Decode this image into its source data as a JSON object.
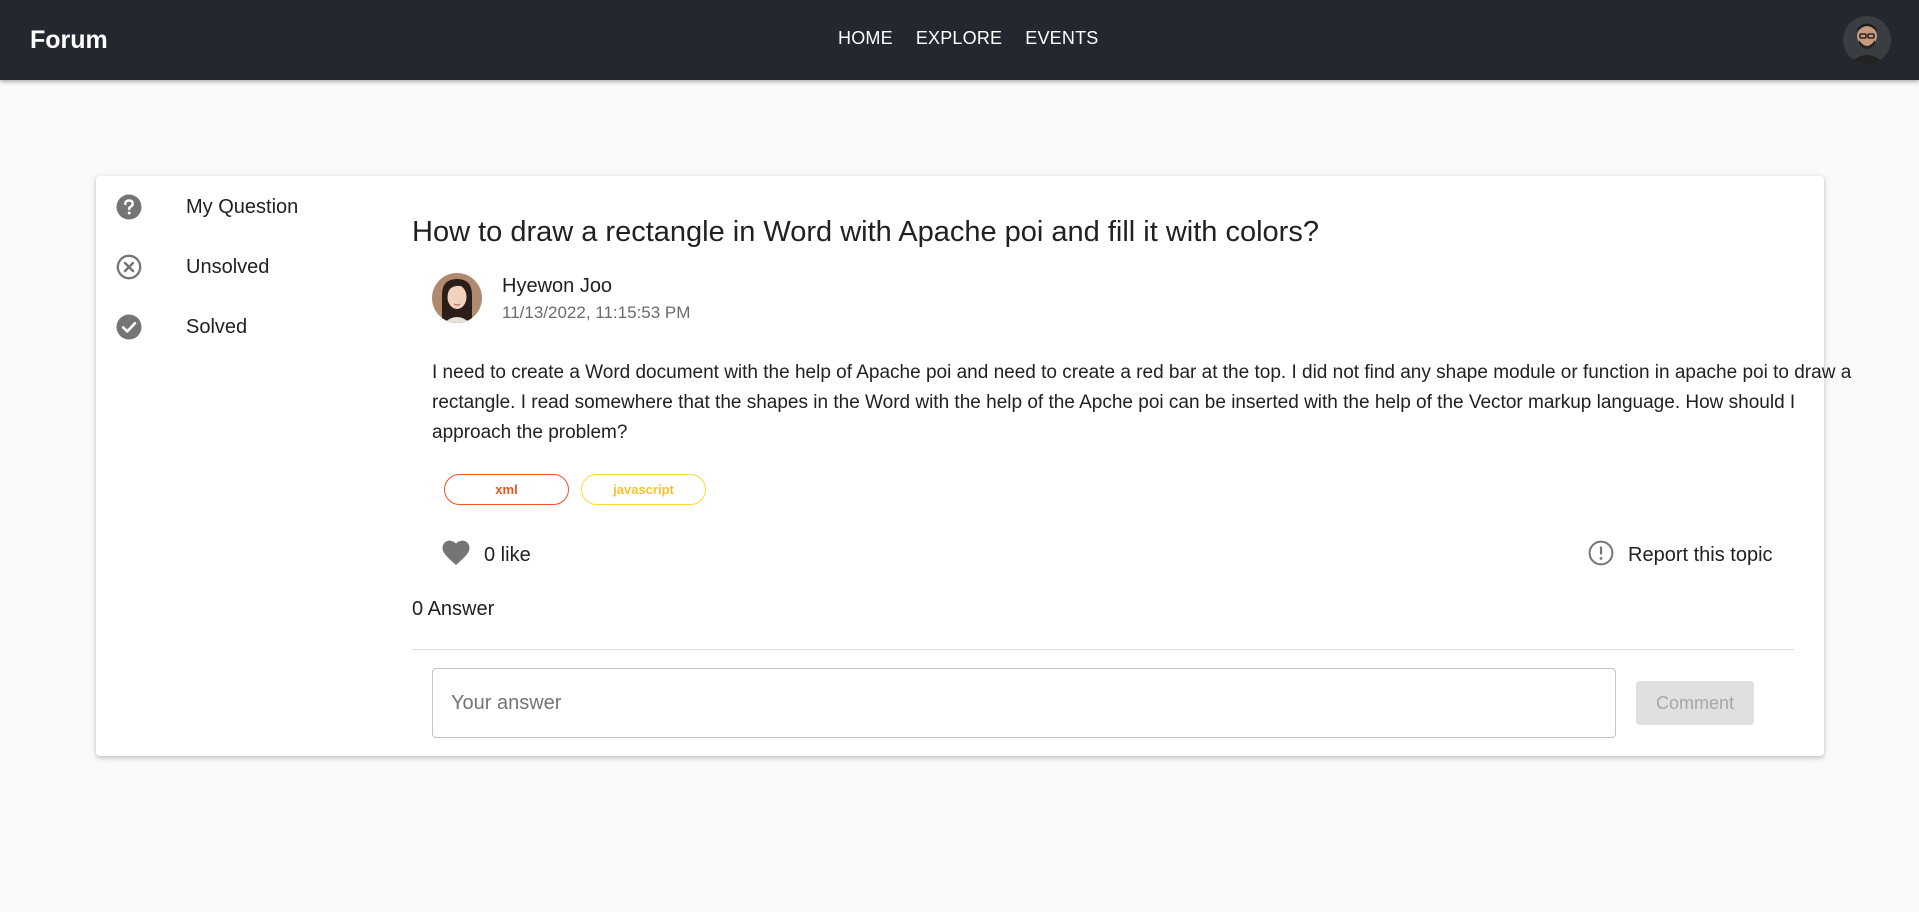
{
  "appbar": {
    "brand": "Forum",
    "nav": [
      "HOME",
      "EXPLORE",
      "EVENTS"
    ],
    "avatar_icon": "user-avatar"
  },
  "sidebar": {
    "items": [
      {
        "label": "My Question",
        "icon": "help-circle-icon"
      },
      {
        "label": "Unsolved",
        "icon": "x-circle-icon"
      },
      {
        "label": "Solved",
        "icon": "check-circle-icon"
      }
    ]
  },
  "post": {
    "title": "How to draw a rectangle in Word with Apache poi and fill it with colors?",
    "author": "Hyewon Joo",
    "date": "11/13/2022, 11:15:53 PM",
    "body": "I need to create a Word document with the help of Apache poi and need to create a red bar at the top. I did not find any shape module or function in apache poi to draw a rectangle. I read somewhere that the shapes in the Word with the help of the Apche poi can be inserted with the help of the Vector markup language. How should I approach the problem?",
    "tags": [
      {
        "label": "xml",
        "color": "#f4511e"
      },
      {
        "label": "javascript",
        "color": "#fdd835"
      }
    ],
    "likes_label": "0 like",
    "report_label": "Report this topic",
    "answers_label": "0 Answer"
  },
  "answer_form": {
    "placeholder": "Your answer",
    "value": "",
    "button_label": "Comment"
  },
  "colors": {
    "appbar_bg": "#232830",
    "icon_gray": "#757575"
  }
}
